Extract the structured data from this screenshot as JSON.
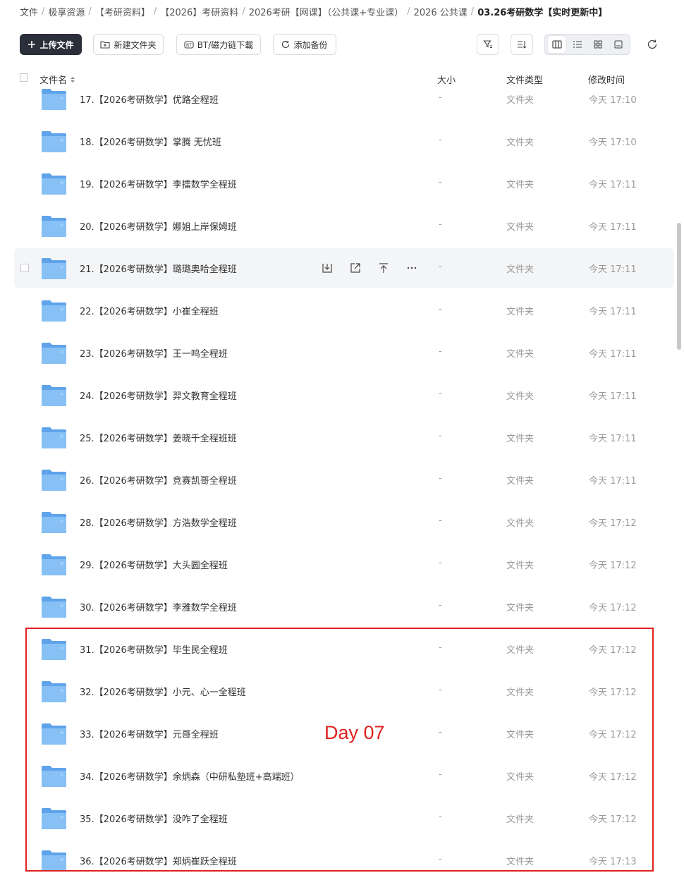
{
  "breadcrumb": [
    {
      "label": "文件"
    },
    {
      "label": "极享资源"
    },
    {
      "label": "【考研资料】"
    },
    {
      "label": "【2026】考研资料"
    },
    {
      "label": "2026考研【网课】（公共课+专业课）"
    },
    {
      "label": "2026 公共课"
    },
    {
      "label": "03.26考研数学【实时更新中】"
    }
  ],
  "toolbar": {
    "upload_label": "上传文件",
    "new_folder_label": "新建文件夹",
    "bt_label": "BT/磁力链下載",
    "backup_label": "添加备份"
  },
  "columns": {
    "name": "文件名",
    "size": "大小",
    "type": "文件类型",
    "time": "修改时间"
  },
  "rows": [
    {
      "name": "17.【2026考研数学】优路全程班",
      "size": "-",
      "type": "文件夹",
      "time": "今天 17:10"
    },
    {
      "name": "18.【2026考研数学】掌腾 无忧班",
      "size": "-",
      "type": "文件夹",
      "time": "今天 17:10"
    },
    {
      "name": "19.【2026考研数学】李擂数学全程班",
      "size": "-",
      "type": "文件夹",
      "time": "今天 17:11"
    },
    {
      "name": "20.【2026考研数学】娜姐上岸保姆班",
      "size": "-",
      "type": "文件夹",
      "time": "今天 17:11"
    },
    {
      "name": "21.【2026考研数学】璐璐奥哈全程班",
      "size": "-",
      "type": "文件夹",
      "time": "今天 17:11"
    },
    {
      "name": "22.【2026考研数学】小崔全程班",
      "size": "-",
      "type": "文件夹",
      "time": "今天 17:11"
    },
    {
      "name": "23.【2026考研数学】王一鸣全程班",
      "size": "-",
      "type": "文件夹",
      "time": "今天 17:11"
    },
    {
      "name": "24.【2026考研数学】羿文教育全程班",
      "size": "-",
      "type": "文件夹",
      "time": "今天 17:11"
    },
    {
      "name": "25.【2026考研数学】姜晓千全程班班",
      "size": "-",
      "type": "文件夹",
      "time": "今天 17:11"
    },
    {
      "name": "26.【2026考研数学】竞赛凯哥全程班",
      "size": "-",
      "type": "文件夹",
      "time": "今天 17:11"
    },
    {
      "name": "28.【2026考研数学】方浩数学全程班",
      "size": "-",
      "type": "文件夹",
      "time": "今天 17:12"
    },
    {
      "name": "29.【2026考研数学】大头圆全程班",
      "size": "-",
      "type": "文件夹",
      "time": "今天 17:12"
    },
    {
      "name": "30.【2026考研数学】李雅数学全程班",
      "size": "-",
      "type": "文件夹",
      "time": "今天 17:12"
    },
    {
      "name": "31.【2026考研数学】毕生民全程班",
      "size": "-",
      "type": "文件夹",
      "time": "今天 17:12"
    },
    {
      "name": "32.【2026考研数学】小元、心一全程班",
      "size": "-",
      "type": "文件夹",
      "time": "今天 17:12"
    },
    {
      "name": "33.【2026考研数学】元哥全程班",
      "size": "-",
      "type": "文件夹",
      "time": "今天 17:12"
    },
    {
      "name": "34.【2026考研数学】余炳森（中研私塾班+高端班）",
      "size": "-",
      "type": "文件夹",
      "time": "今天 17:12"
    },
    {
      "name": "35.【2026考研数学】没咋了全程班",
      "size": "-",
      "type": "文件夹",
      "time": "今天 17:12"
    },
    {
      "name": "36.【2026考研数学】郑炳崔跃全程班",
      "size": "-",
      "type": "文件夹",
      "time": "今天 17:13"
    }
  ],
  "annotation": {
    "label": "Day 07",
    "color": "#e02020"
  },
  "colors": {
    "primary": "#2b2f3a",
    "folder": "#6aaef0",
    "hover": "#f4f5f7"
  }
}
